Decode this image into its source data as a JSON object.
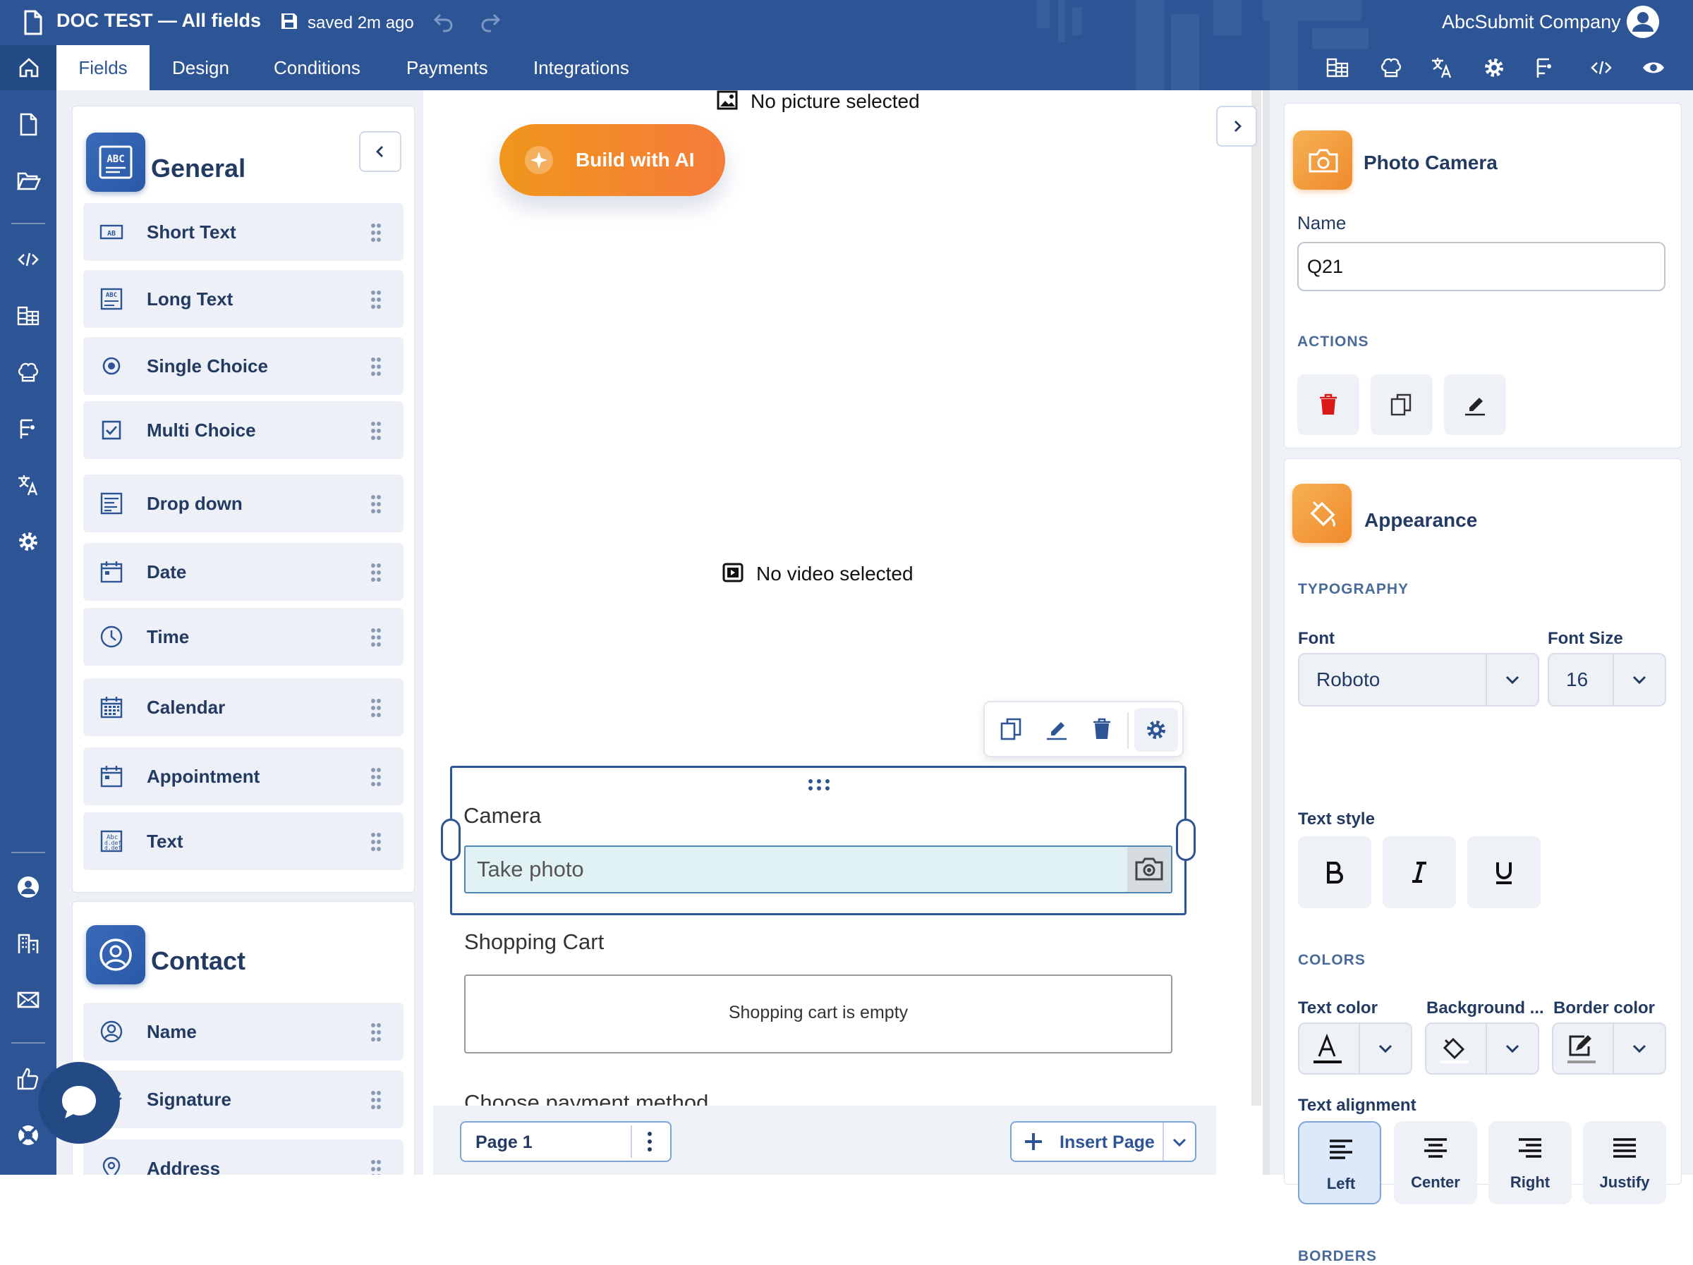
{
  "header": {
    "doc_title": "DOC TEST — All fields",
    "save_status": "saved 2m ago",
    "company": "AbcSubmit Company"
  },
  "tabs": [
    {
      "label": "Fields",
      "active": true
    },
    {
      "label": "Design"
    },
    {
      "label": "Conditions"
    },
    {
      "label": "Payments"
    },
    {
      "label": "Integrations"
    }
  ],
  "general": {
    "title": "General",
    "items": [
      {
        "label": "Short Text",
        "icon": "short-text-icon"
      },
      {
        "label": "Long Text",
        "icon": "long-text-icon"
      },
      {
        "label": "Single Choice",
        "icon": "radio-icon"
      },
      {
        "label": "Multi Choice",
        "icon": "checkbox-icon"
      },
      {
        "label": "Drop down",
        "icon": "dropdown-icon"
      },
      {
        "label": "Date",
        "icon": "date-icon"
      },
      {
        "label": "Time",
        "icon": "clock-icon"
      },
      {
        "label": "Calendar",
        "icon": "calendar-icon"
      },
      {
        "label": "Appointment",
        "icon": "appointment-icon"
      },
      {
        "label": "Text",
        "icon": "text-icon"
      }
    ]
  },
  "contact": {
    "title": "Contact",
    "items": [
      {
        "label": "Name",
        "icon": "person-icon"
      },
      {
        "label": "Signature",
        "icon": "signature-icon"
      },
      {
        "label": "Address",
        "icon": "location-pin-icon"
      }
    ]
  },
  "canvas": {
    "no_picture": "No picture selected",
    "build_ai": "Build with AI",
    "no_video": "No video selected",
    "camera_label": "Camera",
    "camera_placeholder": "Take photo",
    "cart_label": "Shopping Cart",
    "cart_empty": "Shopping cart is empty",
    "payment_label": "Choose payment method",
    "page_name": "Page 1",
    "insert_page": "Insert Page"
  },
  "props": {
    "title": "Photo Camera",
    "name_label": "Name",
    "name_value": "Q21",
    "actions_caption": "ACTIONS",
    "appearance_title": "Appearance",
    "typography_caption": "TYPOGRAPHY",
    "font_label": "Font",
    "font_value": "Roboto",
    "fontsize_label": "Font Size",
    "fontsize_value": "16",
    "textstyle_label": "Text style",
    "colors_caption": "COLORS",
    "text_color_label": "Text color",
    "background_label": "Background ...",
    "border_color_label": "Border color",
    "alignment_label": "Text alignment",
    "align": [
      "Left",
      "Center",
      "Right",
      "Justify"
    ],
    "align_selected": "Left",
    "borders_caption": "BORDERS"
  },
  "colors": {
    "brand": "#2d5595",
    "orange": "#f08a2c",
    "delete": "#d91818",
    "selection_fill": "#e1f2f5"
  }
}
